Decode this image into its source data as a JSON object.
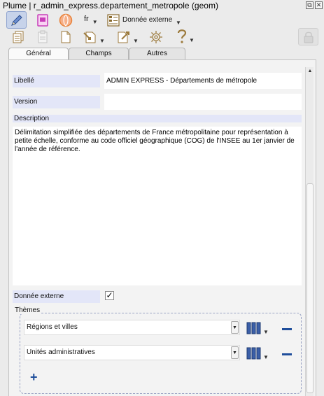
{
  "window": {
    "title": "Plume | r_admin_express.departement_metropole (geom)",
    "btn_float": "⧉",
    "btn_close": "✕"
  },
  "toolbar": {
    "language": "fr",
    "external_data_label": "Donnée externe",
    "dropdown_glyph": "▼"
  },
  "tabs": [
    {
      "label": "Général"
    },
    {
      "label": "Champs"
    },
    {
      "label": "Autres"
    }
  ],
  "form": {
    "libelle_label": "Libellé",
    "libelle_value": "ADMIN EXPRESS - Départements de métropole",
    "version_label": "Version",
    "version_value": "",
    "description_label": "Description",
    "description_value": "Délimitation simplifiée des départements de France métropolitaine pour représentation à petite échelle, conforme au code officiel géographique (COG) de l'INSEE au 1er janvier de l'année de référence.",
    "external_label": "Donnée externe",
    "external_checked": "✓",
    "themes_label": "Thèmes",
    "themes": [
      {
        "value": "Régions et villes"
      },
      {
        "value": "Unités administratives"
      }
    ],
    "add_glyph": "+"
  },
  "colors": {
    "accent_blue": "#1f4e9b",
    "label_bg": "#e3e6f8",
    "pencil_blue": "#3b5fa8",
    "pink": "#c83eb9",
    "orange": "#e8823a",
    "toolbar_brown": "#9c7a3c"
  }
}
